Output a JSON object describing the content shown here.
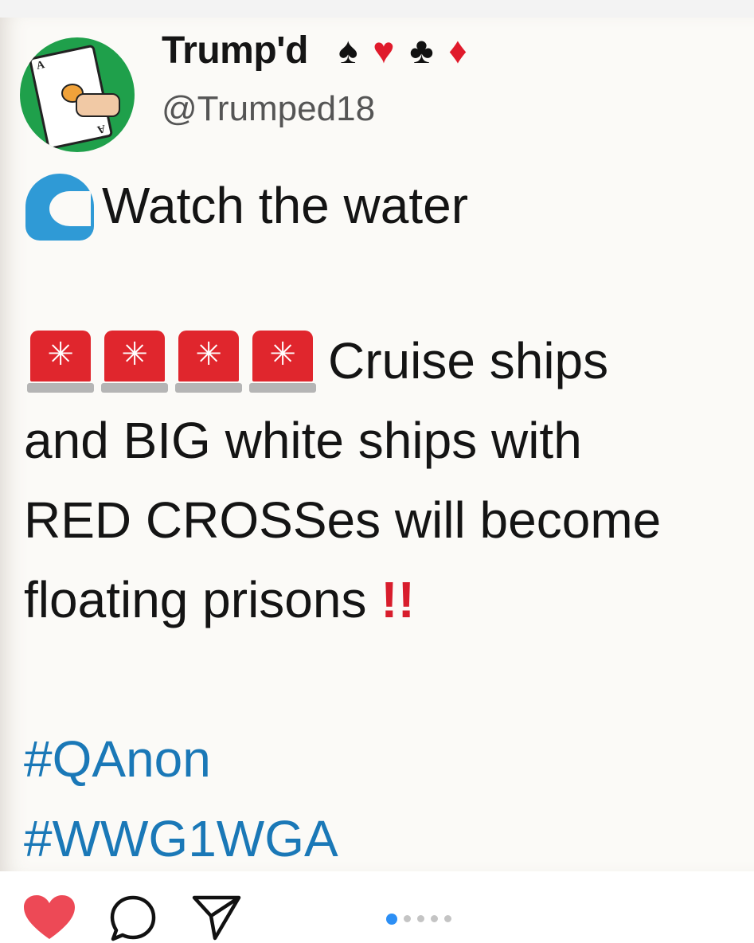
{
  "post": {
    "display_name": "Trump'd",
    "suits": [
      "♠",
      "♥",
      "♣",
      "♦"
    ],
    "handle": "@Trumped18",
    "lines": [
      "Watch the water",
      "Cruise ships",
      "and BIG white ships with",
      "RED CROSSes will become",
      "floating prisons"
    ],
    "emphasis": "!!",
    "hashtags": [
      "#QAnon",
      "#WWG1WGA"
    ],
    "siren_glyph": "✳",
    "icons": {
      "avatar": "playing-card-avatar",
      "wave": "water-wave-icon",
      "siren": "police-siren-icon"
    },
    "colors": {
      "hashtag": "#1a78b7",
      "suit_red": "#e01a2b",
      "siren": "#e0262d",
      "wave": "#2f9ad6"
    }
  },
  "actions": {
    "icons": [
      "heart-icon",
      "comment-icon",
      "share-icon"
    ],
    "liked": true,
    "carousel": {
      "count": 5,
      "active_index": 0
    },
    "colors": {
      "like": "#ed4956",
      "active_dot": "#2c8ff5"
    }
  }
}
